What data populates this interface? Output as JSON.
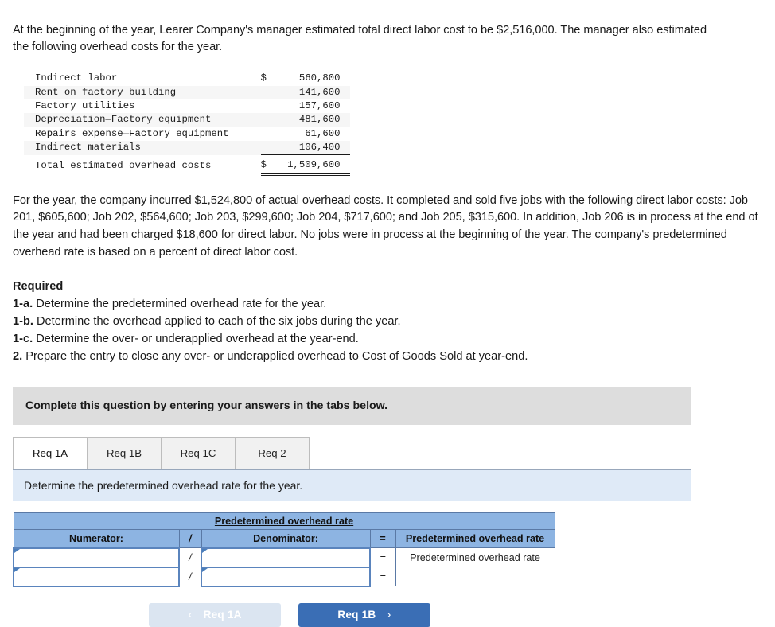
{
  "problem": {
    "intro": "At the beginning of the year, Learer Company's manager estimated total direct labor cost to be $2,516,000. The manager also estimated the following overhead costs for the year.",
    "cost_table": {
      "rows": [
        {
          "label": "Indirect labor",
          "currency": "$",
          "amount": "560,800"
        },
        {
          "label": "Rent on factory building",
          "currency": "",
          "amount": "141,600"
        },
        {
          "label": "Factory utilities",
          "currency": "",
          "amount": "157,600"
        },
        {
          "label": "Depreciation—Factory equipment",
          "currency": "",
          "amount": "481,600"
        },
        {
          "label": "Repairs expense—Factory equipment",
          "currency": "",
          "amount": "61,600"
        },
        {
          "label": "Indirect materials",
          "currency": "",
          "amount": "106,400"
        }
      ],
      "total": {
        "label": "Total estimated overhead costs",
        "currency": "$",
        "amount": "1,509,600"
      }
    },
    "paragraph2": "For the year, the company incurred $1,524,800 of actual overhead costs. It completed and sold five jobs with the following direct labor costs: Job 201, $605,600; Job 202, $564,600; Job 203, $299,600; Job 204, $717,600; and Job 205, $315,600. In addition, Job 206 is in process at the end of the year and had been charged $18,600 for direct labor. No jobs were in process at the beginning of the year. The company's predetermined overhead rate is based on a percent of direct labor cost."
  },
  "required": {
    "title": "Required",
    "items": [
      {
        "num": "1-a.",
        "text": "Determine the predetermined overhead rate for the year."
      },
      {
        "num": "1-b.",
        "text": "Determine the overhead applied to each of the six jobs during the year."
      },
      {
        "num": "1-c.",
        "text": "Determine the over- or underapplied overhead at the year-end."
      },
      {
        "num": "2.",
        "text": "Prepare the entry to close any over- or underapplied overhead to Cost of Goods Sold at year-end."
      }
    ]
  },
  "banner": {
    "text": "Complete this question by entering your answers in the tabs below."
  },
  "tabs": [
    {
      "label": "Req 1A",
      "active": true
    },
    {
      "label": "Req 1B",
      "active": false
    },
    {
      "label": "Req 1C",
      "active": false
    },
    {
      "label": "Req 2",
      "active": false
    }
  ],
  "sub_instruction": "Determine the predetermined overhead rate for the year.",
  "answer_table": {
    "title": "Predetermined overhead rate",
    "headers": {
      "numerator": "Numerator:",
      "slash": "/",
      "denominator": "Denominator:",
      "equals": "=",
      "result": "Predetermined overhead rate"
    },
    "rows": [
      {
        "numerator": "",
        "slash": "/",
        "denominator": "",
        "equals": "=",
        "result": "Predetermined overhead rate"
      },
      {
        "numerator": "",
        "slash": "/",
        "denominator": "",
        "equals": "=",
        "result": ""
      }
    ]
  },
  "navigation": {
    "prev_label": "Req 1A",
    "prev_chevron": "‹",
    "next_label": "Req 1B",
    "next_chevron": "›"
  },
  "colors": {
    "header_blue": "#8db4e2",
    "table_border_blue": "#5a79a5",
    "input_border_blue": "#5a84bd",
    "banner_gray": "#dddddd",
    "sub_bar_blue": "#dfeaf7",
    "next_button_blue": "#3a6eb5",
    "prev_button_blue": "#dbe5f1"
  }
}
